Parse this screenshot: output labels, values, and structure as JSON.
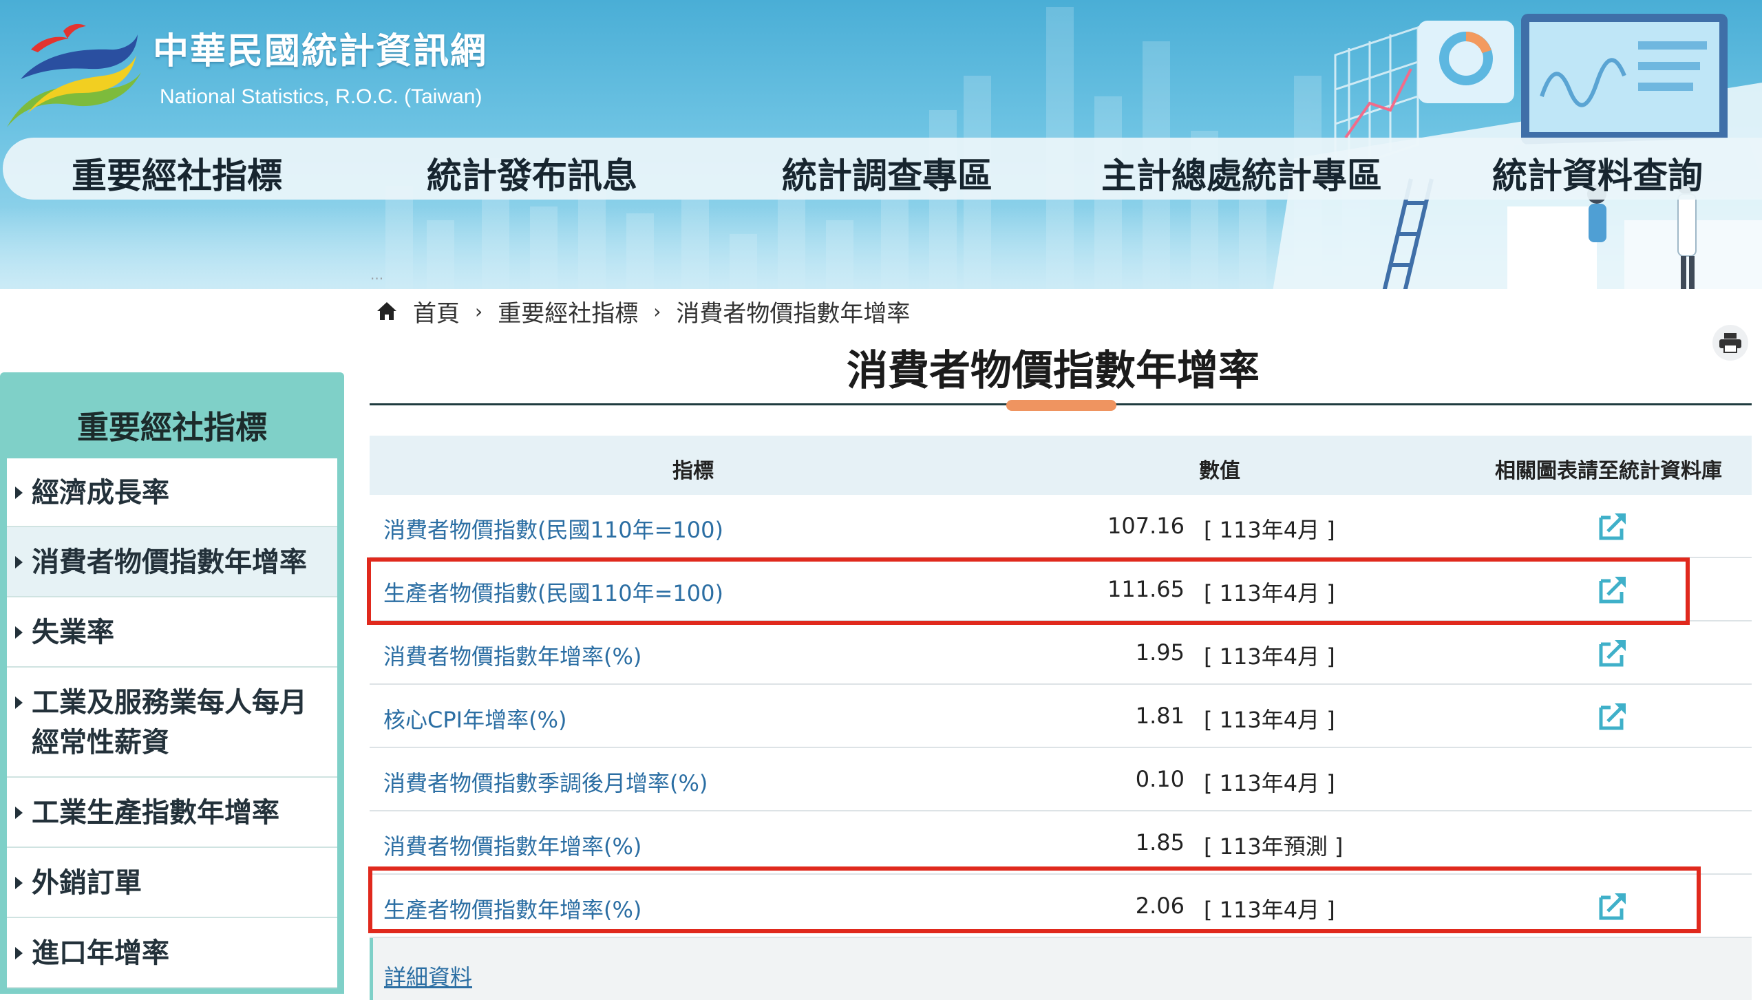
{
  "site": {
    "title": "中華民國統計資訊網",
    "subtitle": "National Statistics, R.O.C. (Taiwan)"
  },
  "nav": {
    "items": [
      "重要經社指標",
      "統計發布訊息",
      "統計調查專區",
      "主計總處統計專區",
      "統計資料查詢"
    ]
  },
  "breadcrumb": {
    "home": "首頁",
    "level1": "重要經社指標",
    "current": "消費者物價指數年增率"
  },
  "page": {
    "title": "消費者物價指數年增率"
  },
  "sidebar": {
    "title": "重要經社指標",
    "items": [
      {
        "label": "經濟成長率"
      },
      {
        "label": "消費者物價指數年增率"
      },
      {
        "label": "失業率"
      },
      {
        "label": "工業及服務業每人每月經常性薪資"
      },
      {
        "label": "工業生產指數年增率"
      },
      {
        "label": "外銷訂單"
      },
      {
        "label": "進口年增率"
      }
    ]
  },
  "table": {
    "headers": {
      "indicator": "指標",
      "value": "數值",
      "link": "相關圖表請至統計資料庫"
    },
    "rows": [
      {
        "name": "消費者物價指數(民國110年=100)",
        "value": "107.16",
        "period": "[ 113年4月 ]"
      },
      {
        "name": "生產者物價指數(民國110年=100)",
        "value": "111.65",
        "period": "[ 113年4月 ]"
      },
      {
        "name": "消費者物價指數年增率(%)",
        "value": "1.95",
        "period": "[ 113年4月 ]"
      },
      {
        "name": "核心CPI年增率(%)",
        "value": "1.81",
        "period": "[ 113年4月 ]"
      },
      {
        "name": "消費者物價指數季調後月增率(%)",
        "value": "0.10",
        "period": "[ 113年4月 ]"
      },
      {
        "name": "消費者物價指數年增率(%)",
        "value": "1.85",
        "period": "[ 113年預測 ]"
      },
      {
        "name": "生產者物價指數年增率(%)",
        "value": "2.06",
        "period": "[ 113年4月 ]"
      }
    ],
    "detail_link": "詳細資料"
  },
  "colors": {
    "accent_teal": "#7fd0c8",
    "link_blue": "#2b6ea3",
    "highlight_red": "#e0291d",
    "title_accent": "#ef9460"
  },
  "icons": {
    "home": "home-icon",
    "print": "printer-icon",
    "external": "external-link-icon"
  }
}
